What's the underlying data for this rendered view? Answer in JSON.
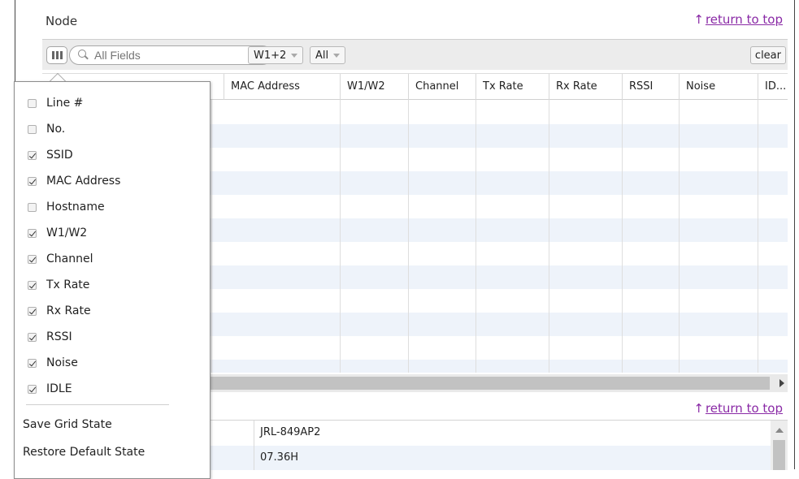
{
  "node": {
    "title": "Node",
    "return_to_top": "return to top"
  },
  "toolbar": {
    "search_placeholder": "All Fields",
    "filter_band": "W1+2",
    "filter_scope": "All",
    "clear_label": "clear"
  },
  "grid": {
    "columns": [
      "MAC Address",
      "W1/W2",
      "Channel",
      "Tx Rate",
      "Rx Rate",
      "RSSI",
      "Noise",
      "ID..."
    ]
  },
  "column_chooser": {
    "items": [
      {
        "label": "Line #",
        "checked": false
      },
      {
        "label": "No.",
        "checked": false
      },
      {
        "label": "SSID",
        "checked": true
      },
      {
        "label": "MAC Address",
        "checked": true
      },
      {
        "label": "Hostname",
        "checked": false
      },
      {
        "label": "W1/W2",
        "checked": true
      },
      {
        "label": "Channel",
        "checked": true
      },
      {
        "label": "Tx Rate",
        "checked": true
      },
      {
        "label": "Rx Rate",
        "checked": true
      },
      {
        "label": "RSSI",
        "checked": true
      },
      {
        "label": "Noise",
        "checked": true
      },
      {
        "label": "IDLE",
        "checked": true
      }
    ],
    "save_label": "Save Grid State",
    "restore_label": "Restore Default State"
  },
  "lower_section": {
    "return_to_top": "return to top",
    "values": [
      "JRL-849AP2",
      "07.36H"
    ]
  },
  "colors": {
    "link": "#8a2aa6",
    "row_alt": "#eef3fa"
  }
}
